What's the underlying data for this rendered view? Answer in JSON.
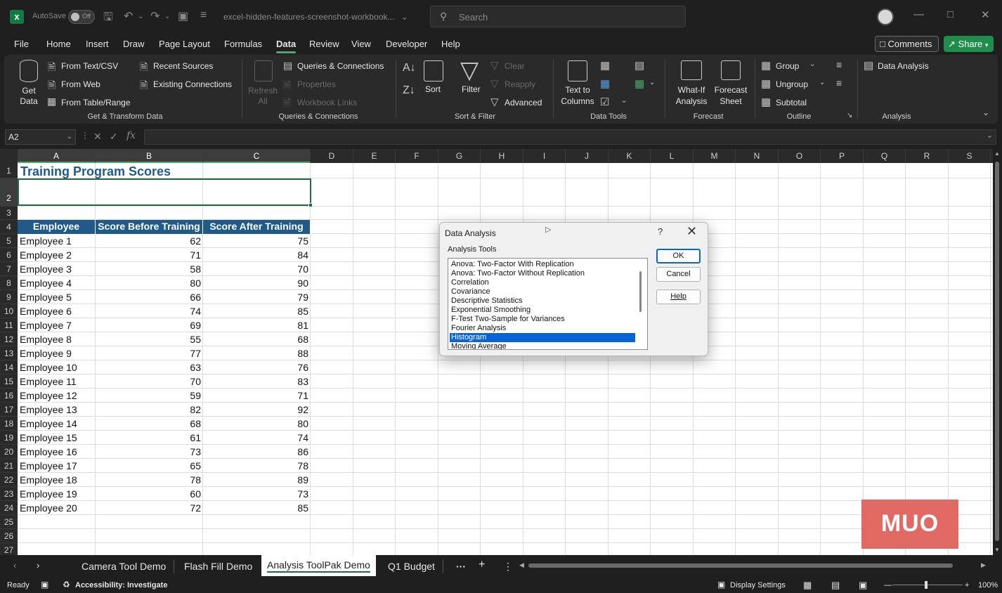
{
  "titlebar": {
    "autosave_label": "AutoSave",
    "autosave_state": "Off",
    "document_title": "excel-hidden-features-screenshot-workbook...",
    "search_placeholder": "Search"
  },
  "menu": {
    "tabs": [
      "File",
      "Home",
      "Insert",
      "Draw",
      "Page Layout",
      "Formulas",
      "Data",
      "Review",
      "View",
      "Developer",
      "Help"
    ],
    "active": "Data",
    "comments_label": "Comments",
    "share_label": "Share"
  },
  "ribbon": {
    "get_transform": {
      "get_data": "Get Data",
      "from_text_csv": "From Text/CSV",
      "from_web": "From Web",
      "from_table_range": "From Table/Range",
      "recent_sources": "Recent Sources",
      "existing_connections": "Existing Connections",
      "group_label": "Get & Transform Data"
    },
    "queries": {
      "refresh_all": "Refresh All",
      "queries_connections": "Queries & Connections",
      "properties": "Properties",
      "workbook_links": "Workbook Links",
      "group_label": "Queries & Connections"
    },
    "sort_filter": {
      "sort": "Sort",
      "filter": "Filter",
      "clear": "Clear",
      "reapply": "Reapply",
      "advanced": "Advanced",
      "group_label": "Sort & Filter"
    },
    "data_tools": {
      "text_to_columns": "Text to Columns",
      "group_label": "Data Tools"
    },
    "forecast": {
      "what_if": "What-If Analysis",
      "forecast_sheet": "Forecast Sheet",
      "group_label": "Forecast"
    },
    "outline": {
      "group": "Group",
      "ungroup": "Ungroup",
      "subtotal": "Subtotal",
      "group_label": "Outline"
    },
    "analysis": {
      "data_analysis": "Data Analysis",
      "group_label": "Analysis"
    }
  },
  "formula_bar": {
    "name_box": "A2",
    "fx": "fx",
    "value": ""
  },
  "grid": {
    "columns": [
      "A",
      "B",
      "C",
      "D",
      "E",
      "F",
      "G",
      "H",
      "I",
      "J",
      "K",
      "L",
      "M",
      "N",
      "O",
      "P",
      "Q",
      "R",
      "S"
    ],
    "rows": [
      "1",
      "2",
      "3",
      "4",
      "5",
      "6",
      "7",
      "8",
      "9",
      "10",
      "11",
      "12",
      "13",
      "14",
      "15",
      "16",
      "17",
      "18",
      "19",
      "20",
      "21",
      "22",
      "23",
      "24",
      "25",
      "26",
      "27"
    ],
    "title": "Training Program Scores",
    "table_headers": [
      "Employee",
      "Score Before Training",
      "Score After Training"
    ],
    "table_rows": [
      [
        "Employee 1",
        "62",
        "75"
      ],
      [
        "Employee 2",
        "71",
        "84"
      ],
      [
        "Employee 3",
        "58",
        "70"
      ],
      [
        "Employee 4",
        "80",
        "90"
      ],
      [
        "Employee 5",
        "66",
        "79"
      ],
      [
        "Employee 6",
        "74",
        "85"
      ],
      [
        "Employee 7",
        "69",
        "81"
      ],
      [
        "Employee 8",
        "55",
        "68"
      ],
      [
        "Employee 9",
        "77",
        "88"
      ],
      [
        "Employee 10",
        "63",
        "76"
      ],
      [
        "Employee 11",
        "70",
        "83"
      ],
      [
        "Employee 12",
        "59",
        "71"
      ],
      [
        "Employee 13",
        "82",
        "92"
      ],
      [
        "Employee 14",
        "68",
        "80"
      ],
      [
        "Employee 15",
        "61",
        "74"
      ],
      [
        "Employee 16",
        "73",
        "86"
      ],
      [
        "Employee 17",
        "65",
        "78"
      ],
      [
        "Employee 18",
        "78",
        "89"
      ],
      [
        "Employee 19",
        "60",
        "73"
      ],
      [
        "Employee 20",
        "72",
        "85"
      ]
    ],
    "header_color": "#1f5a8a"
  },
  "dialog": {
    "title": "Data Analysis",
    "help_glyph": "?",
    "list_label": "Analysis Tools",
    "tools": [
      "Anova: Two-Factor With Replication",
      "Anova: Two-Factor Without Replication",
      "Correlation",
      "Covariance",
      "Descriptive Statistics",
      "Exponential Smoothing",
      "F-Test Two-Sample for Variances",
      "Fourier Analysis",
      "Histogram",
      "Moving Average"
    ],
    "selected": "Histogram",
    "ok": "OK",
    "cancel": "Cancel",
    "help": "Help"
  },
  "sheets": {
    "tabs": [
      "Camera Tool Demo",
      "Flash Fill Demo",
      "Analysis ToolPak Demo",
      "Q1 Budget"
    ],
    "active": "Analysis ToolPak Demo",
    "more": "···",
    "add": "+"
  },
  "status": {
    "ready": "Ready",
    "accessibility": "Accessibility: Investigate",
    "display_settings": "Display Settings",
    "zoom": "100%"
  },
  "watermark": "MUO",
  "colors": {
    "accent_green": "#1f8e4a",
    "selection_blue": "#0a64d6",
    "table_header": "#1f5a8a"
  }
}
